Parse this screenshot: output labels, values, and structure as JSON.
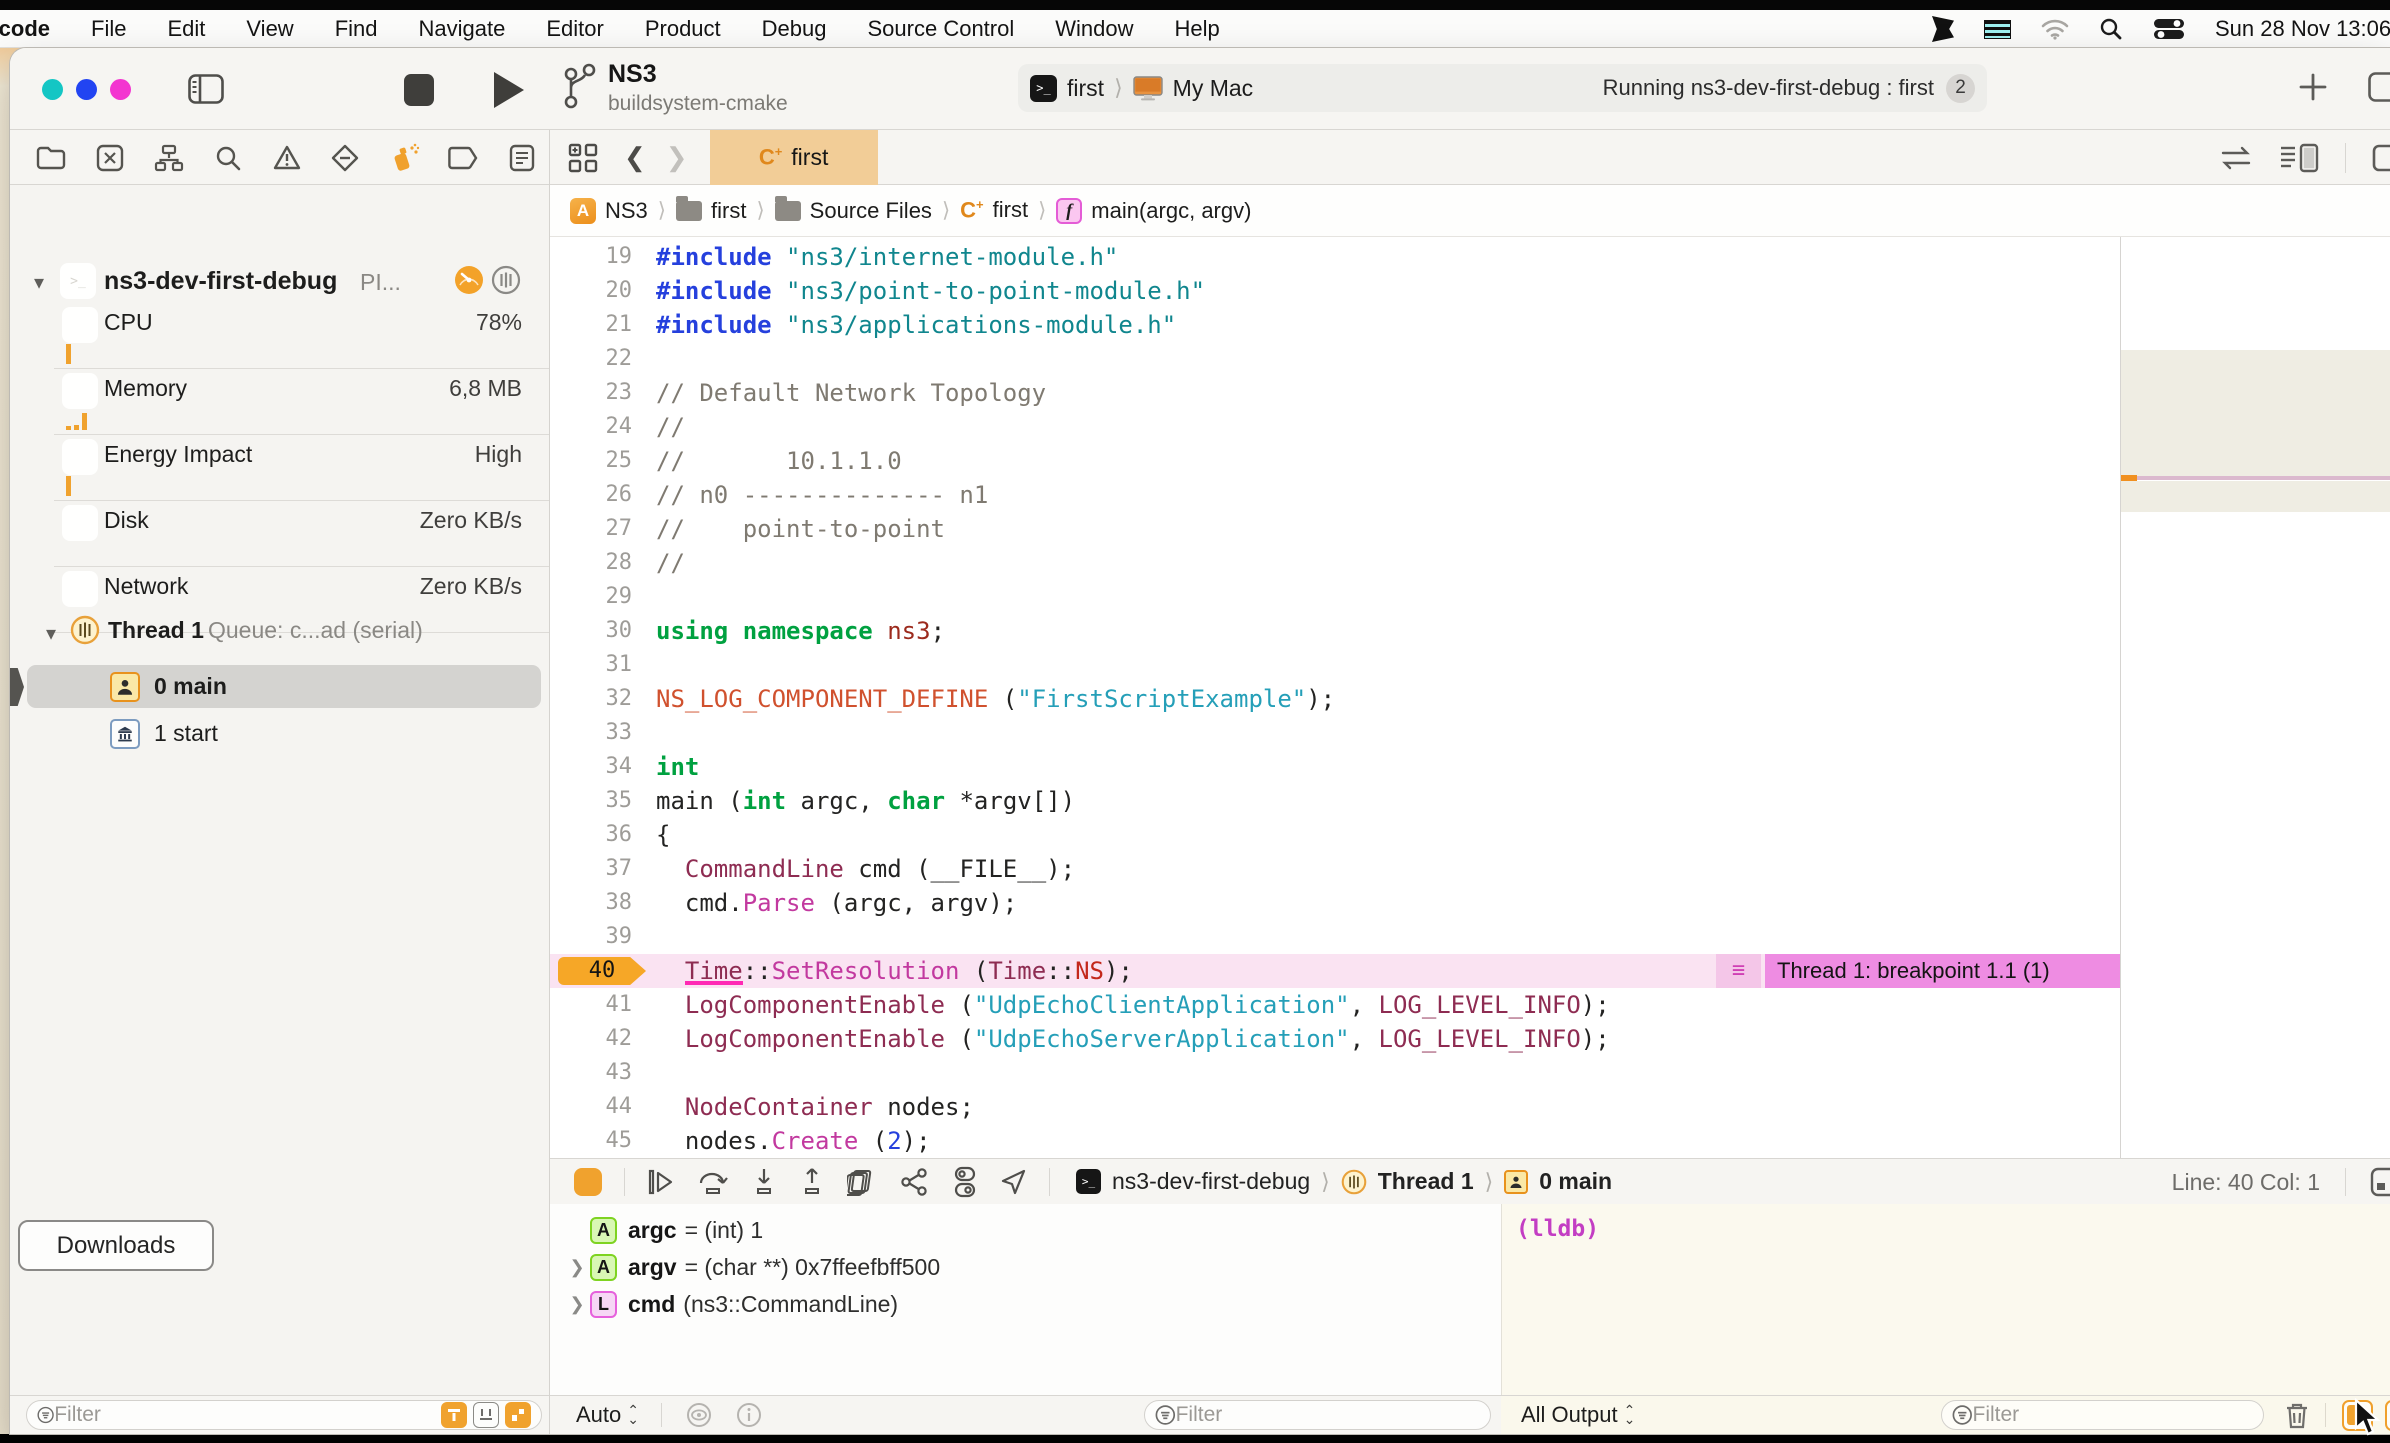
{
  "menu_bar": {
    "items": [
      "Xcode",
      "File",
      "Edit",
      "View",
      "Find",
      "Navigate",
      "Editor",
      "Product",
      "Debug",
      "Source Control",
      "Window",
      "Help"
    ],
    "time": "Sun 28 Nov 13:06"
  },
  "toolbar": {
    "project_name": "NS3",
    "project_subtitle": "buildsystem-cmake",
    "scheme": "first",
    "run_destination": "My Mac",
    "status_text": "Running ns3-dev-first-debug : first",
    "status_badge": "2"
  },
  "tab_bar": {
    "active_tab": "first",
    "lang_c": "C",
    "lang_plus": "+"
  },
  "jump_bar": {
    "items": [
      {
        "icon": "app",
        "label": "NS3"
      },
      {
        "icon": "folder",
        "label": "first"
      },
      {
        "icon": "folder",
        "label": "Source Files"
      },
      {
        "icon": "cpp",
        "label": "first"
      },
      {
        "icon": "func",
        "label": "main(argc, argv)"
      }
    ]
  },
  "sidebar": {
    "project_row": {
      "name": "ns3-dev-first-debug",
      "truncated": "PI..."
    },
    "gauges": [
      {
        "label": "CPU",
        "value": "78%",
        "bars": [
          20
        ]
      },
      {
        "label": "Memory",
        "value": "6,8 MB",
        "bars": [
          4,
          5,
          17
        ]
      },
      {
        "label": "Energy Impact",
        "value": "High",
        "bars": [
          20
        ]
      },
      {
        "label": "Disk",
        "value": "Zero KB/s",
        "bars": []
      },
      {
        "label": "Network",
        "value": "Zero KB/s",
        "bars": []
      }
    ],
    "thread": {
      "title": "Thread 1",
      "queue": "Queue: c...ad (serial)"
    },
    "frames": [
      {
        "label": "0 main",
        "icon": "person",
        "selected": true
      },
      {
        "label": "1 start",
        "icon": "bank",
        "selected": false
      }
    ],
    "downloads_label": "Downloads",
    "filter_placeholder": "Filter"
  },
  "code": {
    "lines": [
      {
        "n": 19,
        "t": [
          [
            "#include",
            "dir"
          ],
          [
            " ",
            "pl"
          ],
          [
            "\"ns3/internet-module.h\"",
            "str"
          ]
        ]
      },
      {
        "n": 20,
        "t": [
          [
            "#include",
            "dir"
          ],
          [
            " ",
            "pl"
          ],
          [
            "\"ns3/point-to-point-module.h\"",
            "str"
          ]
        ]
      },
      {
        "n": 21,
        "t": [
          [
            "#include",
            "dir"
          ],
          [
            " ",
            "pl"
          ],
          [
            "\"ns3/applications-module.h\"",
            "str"
          ]
        ]
      },
      {
        "n": 22,
        "t": []
      },
      {
        "n": 23,
        "t": [
          [
            "// Default Network Topology",
            "cmt"
          ]
        ]
      },
      {
        "n": 24,
        "t": [
          [
            "//",
            "cmt"
          ]
        ]
      },
      {
        "n": 25,
        "t": [
          [
            "//       10.1.1.0",
            "cmt"
          ]
        ]
      },
      {
        "n": 26,
        "t": [
          [
            "// n0 -------------- n1",
            "cmt"
          ]
        ]
      },
      {
        "n": 27,
        "t": [
          [
            "//    point-to-point",
            "cmt"
          ]
        ]
      },
      {
        "n": 28,
        "t": [
          [
            "//",
            "cmt"
          ]
        ]
      },
      {
        "n": 29,
        "t": []
      },
      {
        "n": 30,
        "t": [
          [
            "using",
            "kw"
          ],
          [
            " ",
            "pl"
          ],
          [
            "namespace",
            "kw"
          ],
          [
            " ",
            "pl"
          ],
          [
            "ns3",
            "ns"
          ],
          [
            ";",
            "pl"
          ]
        ]
      },
      {
        "n": 31,
        "t": []
      },
      {
        "n": 32,
        "t": [
          [
            "NS_LOG_COMPONENT_DEFINE",
            "mc"
          ],
          [
            " (",
            "pl"
          ],
          [
            "\"FirstScriptExample\"",
            "str2"
          ],
          [
            ");",
            "pl"
          ]
        ]
      },
      {
        "n": 33,
        "t": []
      },
      {
        "n": 34,
        "t": [
          [
            "int",
            "kw"
          ]
        ]
      },
      {
        "n": 35,
        "t": [
          [
            "main (",
            "pl"
          ],
          [
            "int",
            "kw"
          ],
          [
            " argc, ",
            "pl"
          ],
          [
            "char",
            "kw"
          ],
          [
            " *argv[])",
            "pl"
          ]
        ]
      },
      {
        "n": 36,
        "t": [
          [
            "{",
            "pl"
          ]
        ]
      },
      {
        "n": 37,
        "t": [
          [
            "  ",
            "pl"
          ],
          [
            "CommandLine",
            "tp"
          ],
          [
            " cmd (__FILE__);",
            "pl"
          ]
        ]
      },
      {
        "n": 38,
        "t": [
          [
            "  cmd.",
            "pl"
          ],
          [
            "Parse",
            "fn"
          ],
          [
            " (argc, argv);",
            "pl"
          ]
        ]
      },
      {
        "n": 39,
        "t": []
      },
      {
        "n": 40,
        "bp": true,
        "t": [
          [
            "  ",
            "pl"
          ],
          [
            "Time",
            "tp u"
          ],
          [
            "::",
            "pl"
          ],
          [
            "SetResolution",
            "fn"
          ],
          [
            " (",
            "pl"
          ],
          [
            "Time",
            "tp"
          ],
          [
            "::",
            "pl"
          ],
          [
            "NS",
            "en"
          ],
          [
            ");",
            "pl"
          ]
        ]
      },
      {
        "n": 41,
        "t": [
          [
            "  ",
            "pl"
          ],
          [
            "LogComponentEnable",
            "tp"
          ],
          [
            " (",
            "pl"
          ],
          [
            "\"UdpEchoClientApplication\"",
            "str2"
          ],
          [
            ", ",
            "pl"
          ],
          [
            "LOG_LEVEL_INFO",
            "tp"
          ],
          [
            ");",
            "pl"
          ]
        ]
      },
      {
        "n": 42,
        "t": [
          [
            "  ",
            "pl"
          ],
          [
            "LogComponentEnable",
            "tp"
          ],
          [
            " (",
            "pl"
          ],
          [
            "\"UdpEchoServerApplication\"",
            "str2"
          ],
          [
            ", ",
            "pl"
          ],
          [
            "LOG_LEVEL_INFO",
            "tp"
          ],
          [
            ");",
            "pl"
          ]
        ]
      },
      {
        "n": 43,
        "t": []
      },
      {
        "n": 44,
        "t": [
          [
            "  ",
            "pl"
          ],
          [
            "NodeContainer",
            "tp"
          ],
          [
            " nodes;",
            "pl"
          ]
        ]
      },
      {
        "n": 45,
        "t": [
          [
            "  nodes.",
            "pl"
          ],
          [
            "Create",
            "fn"
          ],
          [
            " (",
            "pl"
          ],
          [
            "2",
            "num"
          ],
          [
            ");",
            "pl"
          ]
        ]
      }
    ]
  },
  "breakpoint": {
    "line": "40",
    "label": "Thread 1: breakpoint 1.1 (1)"
  },
  "debug_bar": {
    "process": "ns3-dev-first-debug",
    "thread": "Thread 1",
    "frame": "0 main",
    "line_col": "Line: 40  Col: 1"
  },
  "variables": [
    {
      "badge": "A",
      "badge_color": "green",
      "expandable": false,
      "name": "argc",
      "value": "= (int) 1"
    },
    {
      "badge": "A",
      "badge_color": "green",
      "expandable": true,
      "name": "argv",
      "value": "= (char **) 0x7ffeefbff500"
    },
    {
      "badge": "L",
      "badge_color": "pink",
      "expandable": true,
      "name": "cmd",
      "value": "(ns3::CommandLine)"
    }
  ],
  "console": {
    "prompt": "(lldb)"
  },
  "bottom_bar": {
    "auto_label": "Auto",
    "all_output_label": "All Output",
    "filter_placeholder": "Filter"
  },
  "colors": {
    "accent_orange": "#f0a22e",
    "breakpoint_row_pink": "#fae3f2",
    "breakpoint_label_pink": "#ee8ce2",
    "tab_active_tan": "#f2cd97",
    "console_cream": "#fbf9ee"
  }
}
